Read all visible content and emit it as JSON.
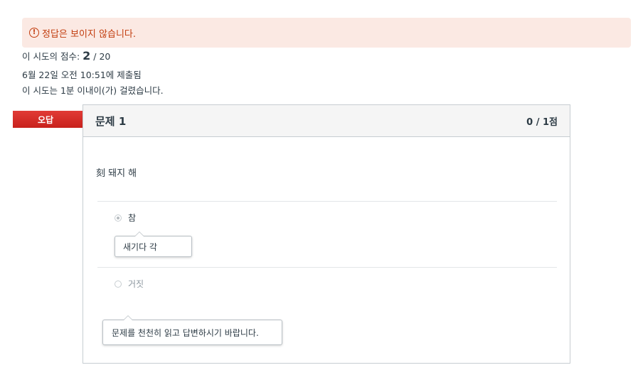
{
  "alert": {
    "icon": "exclamation-circle-icon",
    "text": "정답은 보이지 않습니다."
  },
  "attempt": {
    "score_prefix": "이 시도의 점수: ",
    "score_value": "2",
    "score_total": " / 20",
    "submitted": "6월 22일 오전 10:51에 제출됨",
    "duration": "이 시도는 1분 이내이(가) 걸렸습니다."
  },
  "question": {
    "status_flag": "오답",
    "title": "문제 1",
    "points": "0 / 1점",
    "text": "刻 돼지 해",
    "answers": [
      {
        "label": "참",
        "selected": true,
        "comment": "새기다 각"
      },
      {
        "label": "거짓",
        "selected": false,
        "comment": "문제를 천천히 읽고 답변하시기 바랍니다."
      }
    ]
  },
  "colors": {
    "alert_bg": "#fbe9e3",
    "alert_text": "#c23c0d",
    "incorrect_flag": "#d52d28",
    "border": "#c7cdd1"
  }
}
